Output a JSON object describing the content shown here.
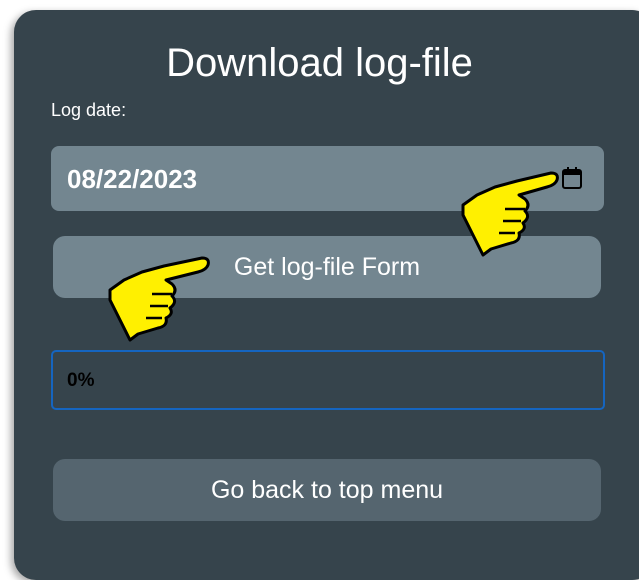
{
  "title": "Download log-file",
  "log_date": {
    "label": "Log date:",
    "value": "08/22/2023",
    "icon": "calendar-icon"
  },
  "buttons": {
    "get_form": "Get log-file Form",
    "back": "Go back to top menu"
  },
  "progress": {
    "text": "0%",
    "value": 0
  },
  "colors": {
    "panel_bg": "#36444c",
    "field_bg": "#738690",
    "back_button_bg": "#55656f",
    "progress_border": "#1565c0",
    "pointer_hand": "#fff000"
  },
  "annotations": {
    "pointer_icons": [
      "pointing-hand-icon",
      "pointing-hand-icon"
    ]
  }
}
